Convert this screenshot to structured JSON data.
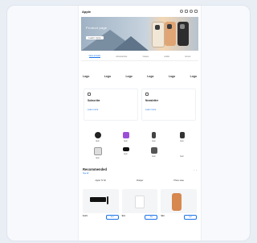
{
  "header": {
    "logo": "Apple",
    "icons": [
      "search-icon",
      "bag-icon",
      "account-icon",
      "menu-icon"
    ]
  },
  "banner": {
    "title": "Product page",
    "button": "Learn more"
  },
  "tabs": [
    {
      "label": "New arrivals",
      "active": true
    },
    {
      "label": "Accessories",
      "active": false
    },
    {
      "label": "Cases",
      "active": false
    },
    {
      "label": "Audio",
      "active": false
    },
    {
      "label": "Home",
      "active": false
    }
  ],
  "brands": [
    "Logo",
    "Logo",
    "Logo",
    "Logo",
    "Logo",
    "Logo"
  ],
  "info_cards": [
    {
      "title": "Subscribe",
      "link": "Learn more"
    },
    {
      "title": "Newsletter",
      "link": "Learn more"
    }
  ],
  "categories": [
    "Item",
    "Item",
    "Item",
    "Item",
    "Item",
    "Item",
    "Item",
    "Item"
  ],
  "recommended": {
    "title": "Recommended",
    "subtitle": "See all",
    "products": [
      {
        "name": "Apple TV 4K",
        "price": "$129",
        "button": "Add"
      },
      {
        "name": "Charger",
        "price": "$19",
        "button": "Add"
      },
      {
        "name": "Phone case",
        "price": "$49",
        "button": "Add"
      }
    ]
  },
  "colors": {
    "accent": "#1a73e8",
    "background": "#e9eef5"
  }
}
